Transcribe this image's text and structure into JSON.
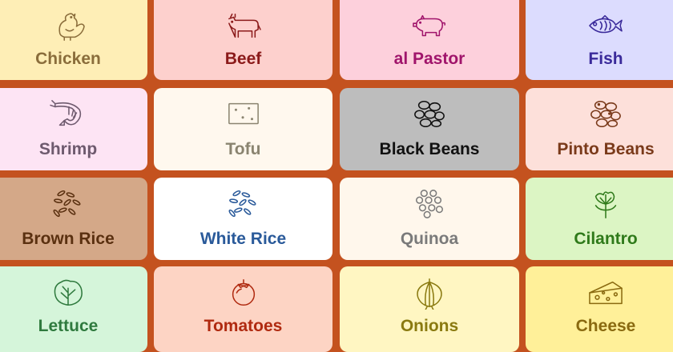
{
  "tiles": [
    {
      "label": "Chicken",
      "icon": "chicken-icon",
      "bg": "#feeeb6",
      "fg": "#8a6d3b"
    },
    {
      "label": "Beef",
      "icon": "cow-icon",
      "bg": "#fdd0cd",
      "fg": "#8b1a1a"
    },
    {
      "label": "al Pastor",
      "icon": "pig-icon",
      "bg": "#fdd0dc",
      "fg": "#a0146b"
    },
    {
      "label": "Fish",
      "icon": "fish-icon",
      "bg": "#dcdcfe",
      "fg": "#3a2a9a"
    },
    {
      "label": "Shrimp",
      "icon": "shrimp-icon",
      "bg": "#fde4f4",
      "fg": "#6e5a6e"
    },
    {
      "label": "Tofu",
      "icon": "tofu-icon",
      "bg": "#fff8ee",
      "fg": "#8a8470"
    },
    {
      "label": "Black Beans",
      "icon": "black-beans-icon",
      "bg": "#bdbdbd",
      "fg": "#111111"
    },
    {
      "label": "Pinto Beans",
      "icon": "pinto-beans-icon",
      "bg": "#fde0da",
      "fg": "#7a3a1a"
    },
    {
      "label": "Brown Rice",
      "icon": "brown-rice-icon",
      "bg": "#d4a888",
      "fg": "#5a3010"
    },
    {
      "label": "White Rice",
      "icon": "white-rice-icon",
      "bg": "#ffffff",
      "fg": "#2a5a9a"
    },
    {
      "label": "Quinoa",
      "icon": "quinoa-icon",
      "bg": "#fff7ec",
      "fg": "#7a7a7a"
    },
    {
      "label": "Cilantro",
      "icon": "cilantro-icon",
      "bg": "#dcf5c4",
      "fg": "#2f7a1a"
    },
    {
      "label": "Lettuce",
      "icon": "lettuce-icon",
      "bg": "#d5f5da",
      "fg": "#2f7a3e"
    },
    {
      "label": "Tomatoes",
      "icon": "tomato-icon",
      "bg": "#fdd4c4",
      "fg": "#b02a10"
    },
    {
      "label": "Onions",
      "icon": "onion-icon",
      "bg": "#fff6c2",
      "fg": "#8a7a10"
    },
    {
      "label": "Cheese",
      "icon": "cheese-icon",
      "bg": "#fff099",
      "fg": "#8a6a10"
    }
  ]
}
